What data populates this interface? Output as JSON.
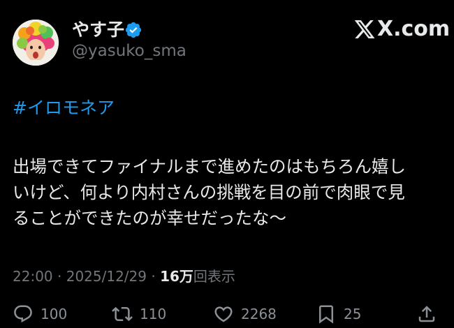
{
  "author": {
    "display_name": "やす子",
    "handle": "@yasuko_sma",
    "verified": true
  },
  "brand": {
    "text": "X.com"
  },
  "tweet": {
    "hashtag": "#イロモネア",
    "lines": [
      "出場できてファイナルまで進めたのはもちろん嬉し",
      "いけど、何より内村さんの挑戦を目の前で肉眼で見",
      "ることができたのが幸せだったな〜"
    ]
  },
  "meta": {
    "time": "22:00",
    "sep1": " · ",
    "date": "2025/12/29",
    "sep2": " · ",
    "views_count": "16万",
    "views_label": "回表示"
  },
  "actions": {
    "replies": "100",
    "reposts": "110",
    "likes": "2268",
    "bookmarks": "25"
  },
  "colors": {
    "background": "#000000",
    "text": "#e7e9ea",
    "secondary": "#71767b",
    "accent": "#1d9bf0"
  },
  "icons": {
    "verified": "verified-badge-icon",
    "reply": "reply-icon",
    "repost": "repost-icon",
    "like": "like-icon",
    "bookmark": "bookmark-icon",
    "share": "share-icon"
  }
}
